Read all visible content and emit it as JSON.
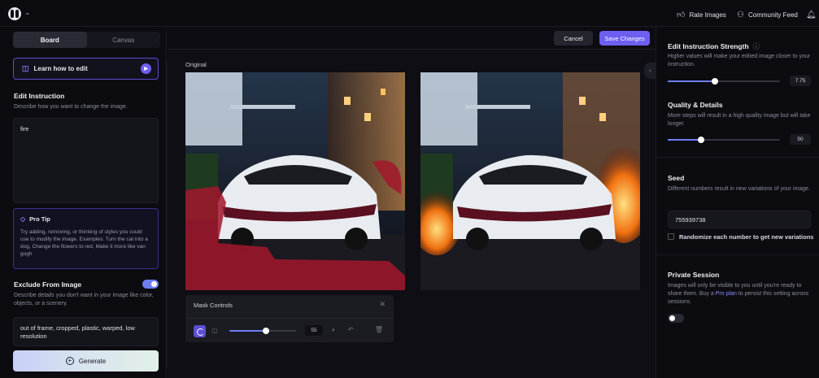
{
  "topbar": {
    "rate_label": "Rate Images",
    "community_label": "Community Feed"
  },
  "left": {
    "tabs": [
      "Board",
      "Canvas"
    ],
    "active_tab": "Board",
    "learn_label": "Learn how to edit",
    "edit_title": "Edit Instruction",
    "edit_desc": "Describe how you want to change the image.",
    "edit_value": "fire",
    "protip_title": "Pro Tip",
    "protip_text": "Try adding, removing, or thinking of styles you could use to modify the image. Examples: Turn the cat into a dog, Change the flowers to red, Make it more like van gogh",
    "exclude_title": "Exclude From Image",
    "exclude_enabled": true,
    "exclude_desc": "Describe details you don't want in your image like color, objects, or a scenery.",
    "exclude_value": "out of frame, cropped, plastic, warped, low resolution",
    "generate_label": "Generate"
  },
  "center": {
    "cancel_label": "Cancel",
    "save_label": "Save Changes",
    "original_label": "Original",
    "mask": {
      "title": "Mask Controls",
      "brush_size": 55,
      "brush_fraction": 0.55
    }
  },
  "right": {
    "strength_title": "Edit Instruction Strength",
    "strength_desc": "Higher values will make your edited image closer to your instruction.",
    "strength_value": "7.75",
    "strength_fraction": 0.42,
    "quality_title": "Quality & Details",
    "quality_desc": "More steps will result in a high quality image but will take longer.",
    "quality_value": "50",
    "quality_fraction": 0.3,
    "seed_title": "Seed",
    "seed_desc": "Different numbers result in new variations of your image.",
    "seed_value": "755939738",
    "randomize_label": "Randomize each number to get new variations",
    "private_title": "Private Session",
    "private_desc_1": "Images will only be visible to you until you're ready to share them. Buy a ",
    "private_link": "Pro plan",
    "private_desc_2": " to persist this setting across sessions.",
    "private_enabled": false
  },
  "colors": {
    "accent": "#6d5ff2",
    "toggle_on": "#6e7ef5",
    "mask_red": "#a2182c"
  }
}
